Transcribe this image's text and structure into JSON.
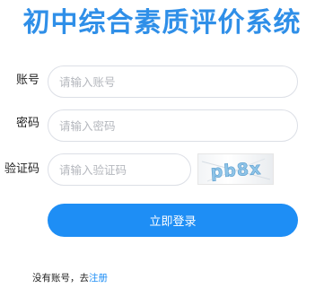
{
  "title": "初中综合素质评价系统",
  "form": {
    "account": {
      "label": "账号",
      "placeholder": "请输入账号",
      "value": ""
    },
    "password": {
      "label": "密码",
      "placeholder": "请输入密码",
      "value": ""
    },
    "captcha": {
      "label": "验证码",
      "placeholder": "请输入验证码",
      "value": "",
      "image_text": "pb8x"
    },
    "submit_label": "立即登录"
  },
  "footer": {
    "prompt": "没有账号，去",
    "register_link": "注册"
  },
  "colors": {
    "brand": "#2f8fe8",
    "button": "#1e8ef5",
    "input_border": "#dcdfe6",
    "placeholder": "#b4b7bd"
  }
}
